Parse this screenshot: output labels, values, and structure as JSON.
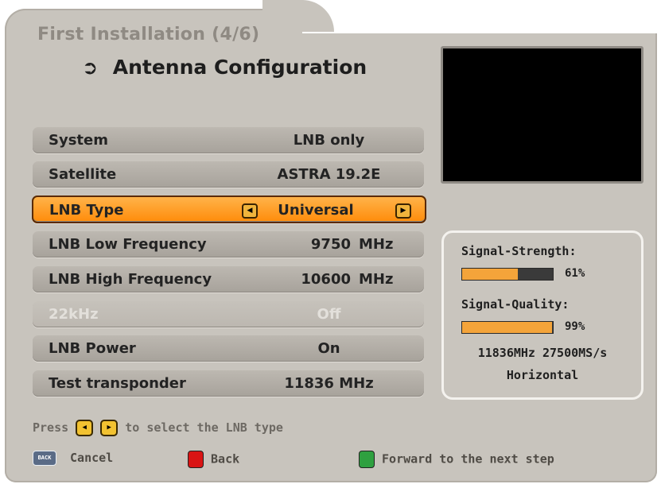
{
  "window": {
    "title": "First Installation (4/6)",
    "heading_icon": "arrow-icon",
    "heading_icon_glyph": "➲",
    "heading": "Antenna Configuration"
  },
  "rows": {
    "system": {
      "label": "System",
      "value": "LNB only"
    },
    "satellite": {
      "label": "Satellite",
      "value": "ASTRA 19.2E"
    },
    "lnb_type": {
      "label": "LNB Type",
      "value": "Universal",
      "left_glyph": "◀",
      "right_glyph": "▶"
    },
    "lnb_low": {
      "label": "LNB Low Frequency",
      "value": "9750",
      "unit": "MHz"
    },
    "lnb_high": {
      "label": "LNB High Frequency",
      "value": "10600",
      "unit": "MHz"
    },
    "khz22": {
      "label": "22kHz",
      "value": "Off"
    },
    "lnb_power": {
      "label": "LNB Power",
      "value": "On"
    },
    "test_transponder": {
      "label": "Test transponder",
      "value": "11836 MHz"
    }
  },
  "signal": {
    "strength_label": "Signal-Strength:",
    "strength_pct_text": "61%",
    "strength_value": 0.61,
    "quality_label": "Signal-Quality:",
    "quality_pct_text": "99%",
    "quality_value": 0.99,
    "transponder_info": "11836MHz 27500MS/s",
    "polarization": "Horizontal",
    "bar_color": "#f4a43a"
  },
  "hint": {
    "prefix": "Press",
    "left_key_glyph": "◀",
    "right_key_glyph": "▶",
    "suffix": "to select the LNB type"
  },
  "footer": {
    "back_key_label": "BACK",
    "cancel_label": "Cancel",
    "back_label": "Back",
    "forward_label": "Forward to the next step",
    "red_key_color": "#d91414",
    "green_key_color": "#2fa040"
  },
  "colors": {
    "accent": "#ff9a1f",
    "panel": "#c8c4bd"
  }
}
